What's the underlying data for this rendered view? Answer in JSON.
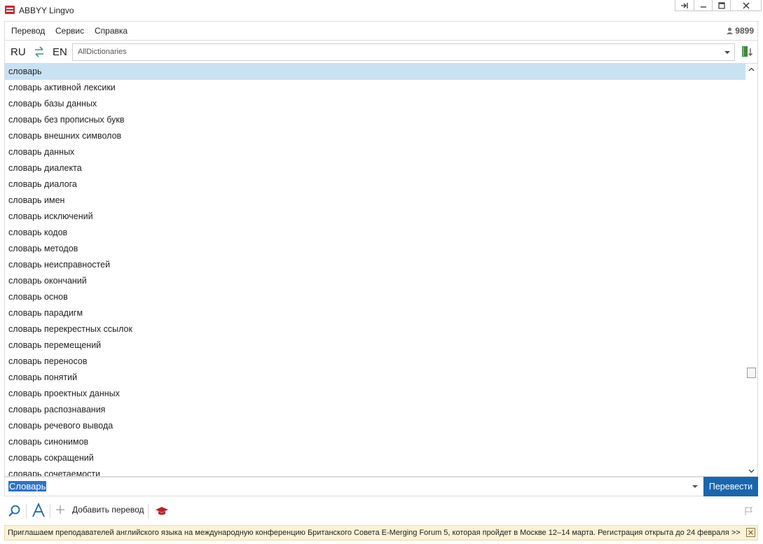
{
  "window": {
    "title": "ABBYY Lingvo",
    "buttons": {
      "pin": "⇥",
      "minimize": "—",
      "maximize": "☐",
      "close": "✕"
    }
  },
  "menu": {
    "items": [
      "Перевод",
      "Сервис",
      "Справка"
    ],
    "score": "9899"
  },
  "lang": {
    "source": "RU",
    "target": "EN",
    "dictionary": "AllDictionaries"
  },
  "words": [
    "словарь",
    "словарь активной лексики",
    "словарь базы данных",
    "словарь без прописных букв",
    "словарь внешних символов",
    "словарь данных",
    "словарь диалекта",
    "словарь диалога",
    "словарь имен",
    "словарь исключений",
    "словарь кодов",
    "словарь методов",
    "словарь неисправностей",
    "словарь окончаний",
    "словарь основ",
    "словарь парадигм",
    "словарь перекрестных ссылок",
    "словарь перемещений",
    "словарь переносов",
    "словарь понятий",
    "словарь проектных данных",
    "словарь распознавания",
    "словарь речевого вывода",
    "словарь синонимов",
    "словарь сокращений",
    "словарь сочетаемости"
  ],
  "search": {
    "query": "Словарь",
    "translate_label": "Перевести"
  },
  "toolbar": {
    "add_translation": "Добавить перевод"
  },
  "banner": {
    "text": "Приглашаем преподавателей английского языка на международную конференцию Британского Совета E-Merging Forum 5, которая пройдет в Москве 12–14 марта. Регистрация открыта до 24 февраля >>"
  },
  "colors": {
    "selection": "#c8e2f4",
    "accent": "#1a66ad",
    "banner_bg": "#fbf3d5"
  }
}
